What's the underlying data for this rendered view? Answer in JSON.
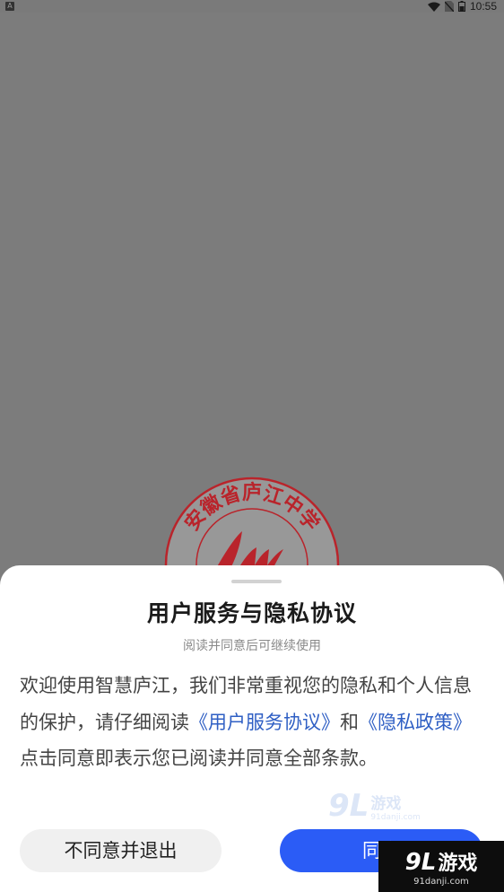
{
  "status_bar": {
    "notification_icon": "A",
    "time": "10:55",
    "icons": [
      "wifi-icon",
      "no-sim-icon",
      "battery-icon"
    ]
  },
  "splash": {
    "logo_text": "安徽省庐江中学",
    "logo_color": "#b9242b"
  },
  "dialog": {
    "title": "用户服务与隐私协议",
    "subtitle": "阅读并同意后可继续使用",
    "body": {
      "part1": "欢迎使用智慧庐江，我们非常重视您的隐私和个人信息的保护，请仔细阅读",
      "link1": "《用户服务协议》",
      "part2": "和",
      "link2": "《隐私政策》",
      "part3": "点击同意即表示您已阅读并同意全部条款。"
    },
    "decline_button": "不同意并退出",
    "accept_button": "同意",
    "accent_color": "#2b5cf6",
    "link_color": "#2f5fc4"
  },
  "watermark": {
    "mark": "9L",
    "name": "游戏",
    "url": "91danji.com"
  }
}
